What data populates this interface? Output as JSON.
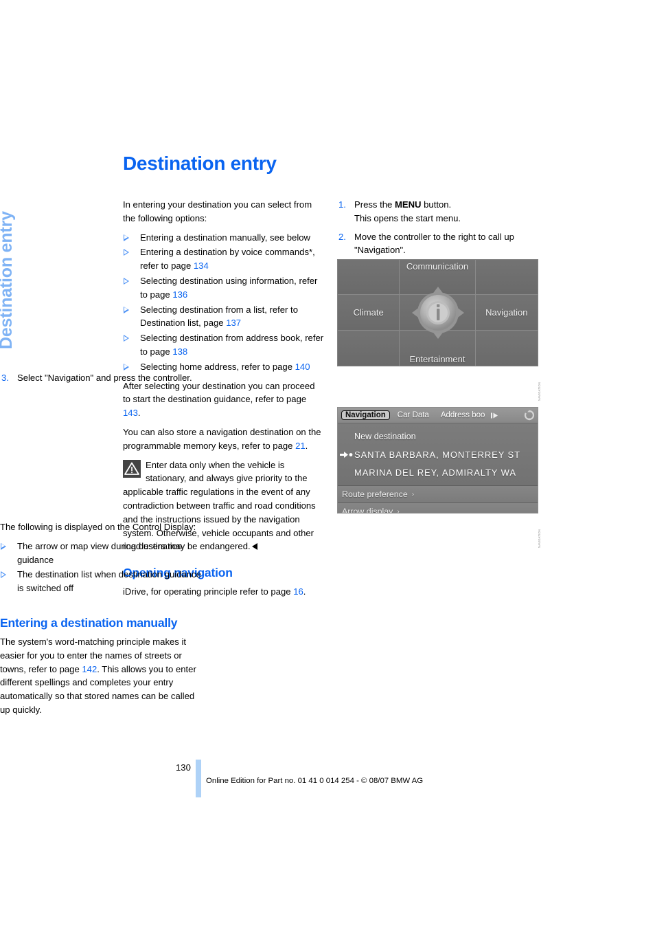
{
  "side_tab": "Destination entry",
  "page_title": "Destination entry",
  "left_column": {
    "intro": "In entering your destination you can select from the following options:",
    "options": [
      {
        "text_before": "Entering a destination manually, see below",
        "page_ref": "",
        "text_after": ""
      },
      {
        "text_before": "Entering a destination by voice commands*, refer to page ",
        "page_ref": "134",
        "text_after": ""
      },
      {
        "text_before": "Selecting destination using information, refer to page ",
        "page_ref": "136",
        "text_after": ""
      },
      {
        "text_before": "Selecting destination from a list, refer to Destination list, page ",
        "page_ref": "137",
        "text_after": ""
      },
      {
        "text_before": "Selecting destination from address book, refer to page ",
        "page_ref": "138",
        "text_after": ""
      },
      {
        "text_before": "Selecting home address, refer to page ",
        "page_ref": "140",
        "text_after": ""
      }
    ],
    "para_after_options_before": "After selecting your destination you can proceed to start the destination guidance, refer to page ",
    "para_after_options_ref": "143",
    "para_after_options_after": ".",
    "para_memory_before": "You can also store a navigation destination on the programmable memory keys, refer to page ",
    "para_memory_ref": "21",
    "para_memory_after": ".",
    "warning_text": "Enter data only when the vehicle is stationary, and always give priority to the applicable traffic regulations in the event of any contradiction between traffic and road conditions and the instructions issued by the navigation system. Otherwise, vehicle occupants and other road users may be endangered.",
    "opening_navigation_heading": "Opening navigation",
    "opening_navigation_before": "iDrive, for operating principle refer to page ",
    "opening_navigation_ref": "16",
    "opening_navigation_after": "."
  },
  "right_column": {
    "steps": [
      {
        "num": "1.",
        "part1": "Press the ",
        "bold": "MENU",
        "part2": " button.",
        "line2": "This opens the start menu."
      },
      {
        "num": "2.",
        "part1": "Move the controller to the right to call up \"Navigation\".",
        "bold": "",
        "part2": "",
        "line2": ""
      },
      {
        "num": "3.",
        "part1": "Select \"Navigation\" and press the controller.",
        "bold": "",
        "part2": "",
        "line2": ""
      }
    ],
    "control_display_intro": "The following is displayed on the Control Display:",
    "display_items": [
      "The arrow or map view during destination guidance",
      "The destination list when destination guidance is switched off"
    ],
    "manual_heading": "Entering a destination manually",
    "manual_before": "The system's word-matching principle makes it easier for you to enter the names of streets or towns, refer to page ",
    "manual_ref": "142",
    "manual_after": ". This allows you to enter different spellings and completes your entry automatically so that stored names can be called up quickly."
  },
  "start_menu_screenshot": {
    "cells": {
      "communication": "Communication",
      "climate": "Climate",
      "navigation": "Navigation",
      "entertainment": "Entertainment"
    },
    "center_icon": "info-icon",
    "caption": "NAVIGATION"
  },
  "nav_menu_screenshot": {
    "tabs": [
      {
        "label": "Navigation",
        "active": true
      },
      {
        "label": "Car Data",
        "active": false
      },
      {
        "label": "Address boo",
        "active": false
      }
    ],
    "scroll_arrow_icon": "scroll-right-icon",
    "refresh_icon": "refresh-icon",
    "list_items": [
      {
        "label": "New destination",
        "marker": false
      },
      {
        "label": "SANTA BARBARA, MONTERREY ST",
        "marker": true
      },
      {
        "label": "MARINA DEL REY, ADMIRALTY WA",
        "marker": false
      }
    ],
    "footer_rows": [
      {
        "label": "Route preference",
        "chevron": "›"
      },
      {
        "label": "Arrow display",
        "chevron": "›"
      }
    ],
    "caption": "NAVIGATION"
  },
  "footer": {
    "page_number": "130",
    "text": "Online Edition for Part no. 01 41 0 014 254 - © 08/07 BMW AG"
  },
  "colors": {
    "accent_blue": "#0a64f0",
    "tab_blue": "#7fb3f5",
    "footer_bar_blue": "#aed2f7"
  }
}
